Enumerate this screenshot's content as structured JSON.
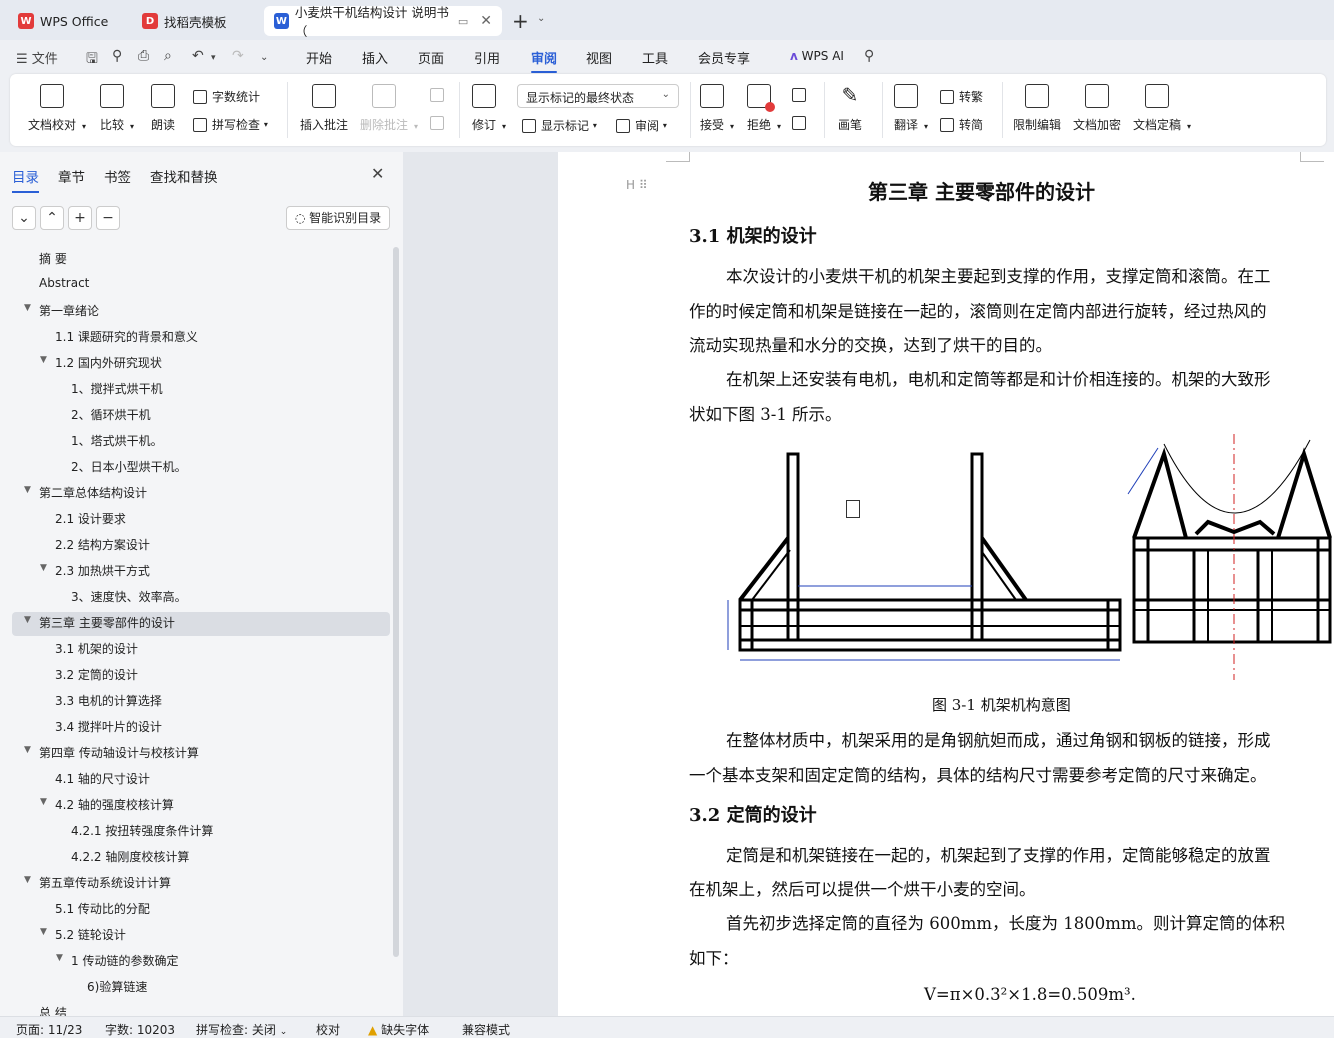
{
  "tabs": [
    {
      "label": "WPS Office",
      "icon": "wps-logo-icon",
      "color": "#e23b3b"
    },
    {
      "label": "找稻壳模板",
      "icon": "docer-logo-icon",
      "color": "#e23b3b"
    },
    {
      "label": "小麦烘干机结构设计 说明书（",
      "icon": "word-doc-icon",
      "color": "#2a5fd6"
    }
  ],
  "menu": {
    "file": "文件",
    "items": [
      "开始",
      "插入",
      "页面",
      "引用",
      "审阅",
      "视图",
      "工具",
      "会员专享"
    ],
    "active": "审阅",
    "wps_ai": "WPS AI"
  },
  "ribbon": {
    "doc_proof": "文档校对",
    "compare": "比较",
    "read_aloud": "朗读",
    "word_count": "字数统计",
    "spell_check": "拼写检查",
    "insert_comment": "插入批注",
    "delete_comment": "删除批注",
    "track": "修订",
    "markup_state": "显示标记的最终状态",
    "show_markup": "显示标记",
    "review": "审阅",
    "accept": "接受",
    "reject": "拒绝",
    "pen": "画笔",
    "translate": "翻译",
    "to_trad": "转繁",
    "to_simp": "转简",
    "restrict": "限制编辑",
    "encrypt": "文档加密",
    "finalize": "文档定稿"
  },
  "sidebar": {
    "tabs": [
      "目录",
      "章节",
      "书签",
      "查找和替换"
    ],
    "active_tab": "目录",
    "smart_toc": "智能识别目录",
    "toc": [
      {
        "label": "摘  要",
        "level": 0,
        "caret": ""
      },
      {
        "label": "Abstract",
        "level": 0,
        "caret": ""
      },
      {
        "label": "第一章绪论",
        "level": 0,
        "caret": "▼"
      },
      {
        "label": "1.1  课题研究的背景和意义",
        "level": 1,
        "caret": ""
      },
      {
        "label": "1.2  国内外研究现状",
        "level": 1,
        "caret": "▼"
      },
      {
        "label": "1、搅拌式烘干机",
        "level": 2,
        "caret": ""
      },
      {
        "label": "2、循环烘干机",
        "level": 2,
        "caret": ""
      },
      {
        "label": "1、塔式烘干机。",
        "level": 2,
        "caret": ""
      },
      {
        "label": "2、日本小型烘干机。",
        "level": 2,
        "caret": ""
      },
      {
        "label": "第二章总体结构设计",
        "level": 0,
        "caret": "▼"
      },
      {
        "label": "2.1  设计要求",
        "level": 1,
        "caret": ""
      },
      {
        "label": "2.2  结构方案设计",
        "level": 1,
        "caret": ""
      },
      {
        "label": "2.3  加热烘干方式",
        "level": 1,
        "caret": "▼"
      },
      {
        "label": "3、速度快、效率高。",
        "level": 2,
        "caret": ""
      },
      {
        "label": "第三章  主要零部件的设计",
        "level": 0,
        "caret": "▼"
      },
      {
        "label": "3.1  机架的设计",
        "level": 1,
        "caret": ""
      },
      {
        "label": "3.2  定筒的设计",
        "level": 1,
        "caret": ""
      },
      {
        "label": "3.3 电机的计算选择",
        "level": 1,
        "caret": ""
      },
      {
        "label": "3.4  搅拌叶片的设计",
        "level": 1,
        "caret": ""
      },
      {
        "label": "第四章  传动轴设计与校核计算",
        "level": 0,
        "caret": "▼"
      },
      {
        "label": "4.1  轴的尺寸设计",
        "level": 1,
        "caret": ""
      },
      {
        "label": "4.2  轴的强度校核计算",
        "level": 1,
        "caret": "▼"
      },
      {
        "label": "4.2.1  按扭转强度条件计算",
        "level": 2,
        "caret": ""
      },
      {
        "label": "4.2.2 轴刚度校核计算",
        "level": 2,
        "caret": ""
      },
      {
        "label": "第五章传动系统设计计算",
        "level": 0,
        "caret": "▼"
      },
      {
        "label": "5.1  传动比的分配",
        "level": 1,
        "caret": ""
      },
      {
        "label": "5.2  链轮设计",
        "level": 1,
        "caret": "▼"
      },
      {
        "label": "1 传动链的参数确定",
        "level": 2,
        "caret": "▼"
      },
      {
        "label": "6)验算链速",
        "level": 3,
        "caret": ""
      },
      {
        "label": "总  结",
        "level": 0,
        "caret": ""
      }
    ],
    "selected_index": 14
  },
  "document": {
    "chapter_title": "第三章  主要零部件的设计",
    "s31_title": "3.1  机架的设计",
    "p1_l1": "本次设计的小麦烘干机的机架主要起到支撑的作用，支撑定筒和滚筒。在工",
    "p1_l2": "作的时候定筒和机架是链接在一起的，滚筒则在定筒内部进行旋转，经过热风的",
    "p1_l3": "流动实现热量和水分的交换，达到了烘干的目的。",
    "p2_l1": "在机架上还安装有电机，电机和定筒等都是和计价相连接的。机架的大致形",
    "p2_l2": "状如下图 3-1 所示。",
    "figure_caption": "图 3-1  机架机构意图",
    "p3_l1": "在整体材质中，机架采用的是角钢航妲而成，通过角钢和钢板的链接，形成",
    "p3_l2": "一个基本支架和固定定筒的结构，具体的结构尺寸需要参考定筒的尺寸来确定。",
    "s32_title": "3.2  定筒的设计",
    "p4_l1": "定筒是和机架链接在一起的，机架起到了支撑的作用，定筒能够稳定的放置",
    "p4_l2": "在机架上，然后可以提供一个烘干小麦的空间。",
    "p5_l1": "首先初步选择定筒的直径为 600mm，长度为 1800mm。则计算定筒的体积",
    "p5_l2": "如下：",
    "formula": "V=π×0.3²×1.8=0.509m³."
  },
  "status": {
    "page": "页面: 11/23",
    "words": "字数: 10203",
    "spell": "拼写检查: 关闭",
    "proof": "校对",
    "missing_font": "缺失字体",
    "compat": "兼容模式"
  },
  "colors": {
    "accent": "#2a5fd6",
    "wps_red": "#e23b3b"
  }
}
